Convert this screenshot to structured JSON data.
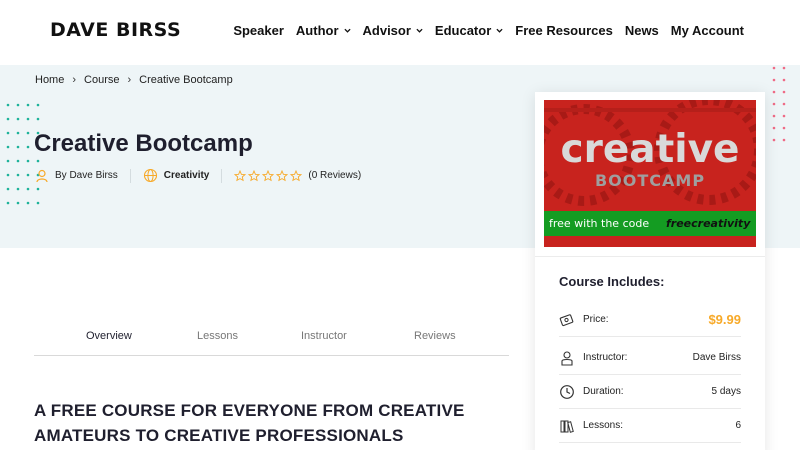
{
  "header": {
    "logo": "DAVE BIRSS",
    "nav": [
      {
        "label": "Speaker",
        "dropdown": false
      },
      {
        "label": "Author",
        "dropdown": true
      },
      {
        "label": "Advisor",
        "dropdown": true
      },
      {
        "label": "Educator",
        "dropdown": true
      },
      {
        "label": "Free Resources",
        "dropdown": false
      },
      {
        "label": "News",
        "dropdown": false
      },
      {
        "label": "My Account",
        "dropdown": false
      }
    ]
  },
  "breadcrumb": [
    "Home",
    "Course",
    "Creative Bootcamp"
  ],
  "course": {
    "title": "Creative Bootcamp",
    "author": "By Dave Birss",
    "category": "Creativity",
    "rating": 0,
    "reviews": "(0 Reviews)"
  },
  "tabs": [
    "Overview",
    "Lessons",
    "Instructor",
    "Reviews"
  ],
  "active_tab": "Overview",
  "section_heading": "A FREE COURSE FOR EVERYONE FROM CREATIVE AMATEURS TO CREATIVE PROFESSIONALS",
  "image": {
    "word1": "creative",
    "word2": "BOOTCAMP",
    "strip_text": "free with the code",
    "code": "freecreativity"
  },
  "sidebar": {
    "title": "Course Includes:",
    "rows": [
      {
        "label": "Price:",
        "value": "$9.99",
        "icon": "price-tag-icon"
      },
      {
        "label": "Instructor:",
        "value": "Dave Birss",
        "icon": "instructor-icon"
      },
      {
        "label": "Duration:",
        "value": "5 days",
        "icon": "clock-icon"
      },
      {
        "label": "Lessons:",
        "value": "6",
        "icon": "books-icon"
      }
    ]
  },
  "colors": {
    "accent_teal": "#1fb39a",
    "accent_pink": "#ef6b86",
    "price": "#f7a928",
    "image_red": "#c8231e",
    "image_green": "#149c22"
  }
}
